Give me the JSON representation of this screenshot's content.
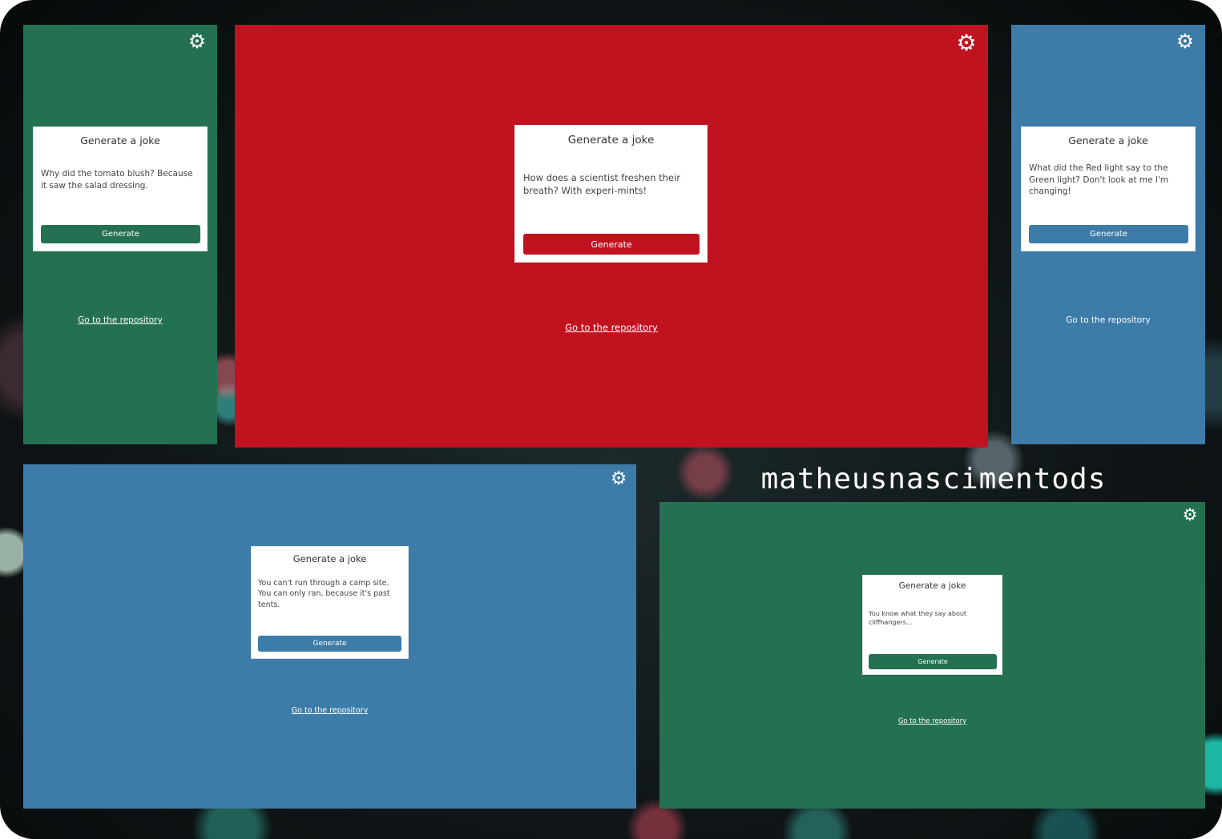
{
  "watermark": "matheusnascimentods",
  "gear_icon": "gear-icon",
  "colors": {
    "green": "#247152",
    "red": "#c1121f",
    "blue": "#3d7ba8"
  },
  "screens": {
    "top_left": {
      "title": "Generate a joke",
      "joke": "Why did the tomato blush? Because it saw the salad dressing.",
      "button": "Generate",
      "link": "Go to the repository"
    },
    "top_center": {
      "title": "Generate a joke",
      "joke": "How does a scientist freshen their breath? With experi-mints!",
      "button": "Generate",
      "link": "Go to the repository"
    },
    "top_right": {
      "title": "Generate a joke",
      "joke": "What did the Red light say to the Green light? Don't look at me I'm changing!",
      "button": "Generate",
      "link": "Go to the repository"
    },
    "bottom_left": {
      "title": "Generate a joke",
      "joke": "You can't run through a camp site. You can only ran, because it's past tents.",
      "button": "Generate",
      "link": "Go to the repository"
    },
    "bottom_right": {
      "title": "Generate a joke",
      "joke": "You know what they say about cliffhangers...",
      "button": "Generate",
      "link": "Go to the repository"
    }
  }
}
